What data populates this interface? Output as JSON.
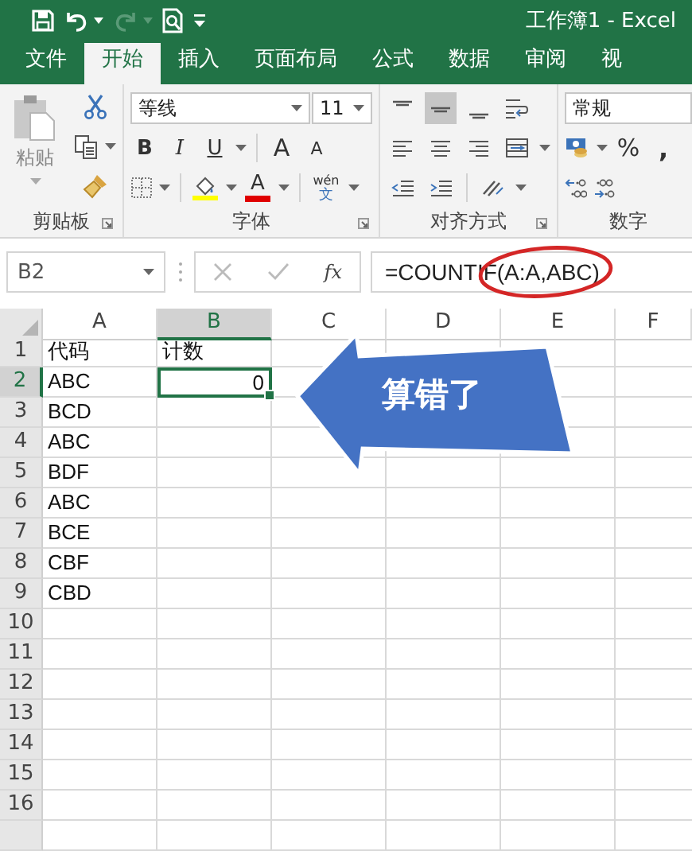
{
  "window": {
    "title": "工作簿1 - Excel"
  },
  "tabs": [
    {
      "label": "文件",
      "selected": false
    },
    {
      "label": "开始",
      "selected": true
    },
    {
      "label": "插入",
      "selected": false
    },
    {
      "label": "页面布局",
      "selected": false
    },
    {
      "label": "公式",
      "selected": false
    },
    {
      "label": "数据",
      "selected": false
    },
    {
      "label": "审阅",
      "selected": false
    },
    {
      "label": "视",
      "selected": false
    }
  ],
  "ribbon": {
    "clipboard": {
      "label": "剪贴板",
      "paste": "粘贴"
    },
    "font": {
      "label": "字体",
      "font_name": "等线",
      "font_size": "11",
      "bold": "B",
      "italic": "I",
      "underline": "U",
      "grow": "A",
      "shrink": "A",
      "font_color": "A",
      "phonetic": "wén",
      "phonetic_base": "文"
    },
    "alignment": {
      "label": "对齐方式",
      "vertical": [
        {
          "selected": false
        },
        {
          "selected": true
        },
        {
          "selected": false
        }
      ]
    },
    "number": {
      "label": "数字",
      "format": "常规",
      "percent": "%",
      "comma": ","
    }
  },
  "formula_bar": {
    "name_box": "B2",
    "fx": "fx",
    "formula": "=COUNTIF(A:A,ABC)"
  },
  "columns": [
    {
      "label": "A",
      "selected": false
    },
    {
      "label": "B",
      "selected": true
    },
    {
      "label": "C",
      "selected": false
    },
    {
      "label": "D",
      "selected": false
    },
    {
      "label": "E",
      "selected": false
    },
    {
      "label": "F",
      "selected": false
    }
  ],
  "rows": [
    {
      "number": "1",
      "selected": false,
      "cells": [
        {
          "text": "代码",
          "selected": false
        },
        {
          "text": "计数",
          "selected": false
        }
      ]
    },
    {
      "number": "2",
      "selected": true,
      "cells": [
        {
          "text": "ABC",
          "selected": false
        },
        {
          "text": "0",
          "kind": "number",
          "selected": true
        }
      ]
    },
    {
      "number": "3",
      "selected": false,
      "cells": [
        {
          "text": "BCD",
          "selected": false
        }
      ]
    },
    {
      "number": "4",
      "selected": false,
      "cells": [
        {
          "text": "ABC",
          "selected": false
        }
      ]
    },
    {
      "number": "5",
      "selected": false,
      "cells": [
        {
          "text": "BDF",
          "selected": false
        }
      ]
    },
    {
      "number": "6",
      "selected": false,
      "cells": [
        {
          "text": "ABC",
          "selected": false
        }
      ]
    },
    {
      "number": "7",
      "selected": false,
      "cells": [
        {
          "text": "BCE",
          "selected": false
        }
      ]
    },
    {
      "number": "8",
      "selected": false,
      "cells": [
        {
          "text": "CBF",
          "selected": false
        }
      ]
    },
    {
      "number": "9",
      "selected": false,
      "cells": [
        {
          "text": "CBD",
          "selected": false
        }
      ]
    },
    {
      "number": "10",
      "selected": false
    },
    {
      "number": "11",
      "selected": false
    },
    {
      "number": "12",
      "selected": false
    },
    {
      "number": "13",
      "selected": false
    },
    {
      "number": "14",
      "selected": false
    },
    {
      "number": "15",
      "selected": false
    },
    {
      "number": "16",
      "selected": false
    }
  ],
  "callout": {
    "text": "算错了"
  }
}
